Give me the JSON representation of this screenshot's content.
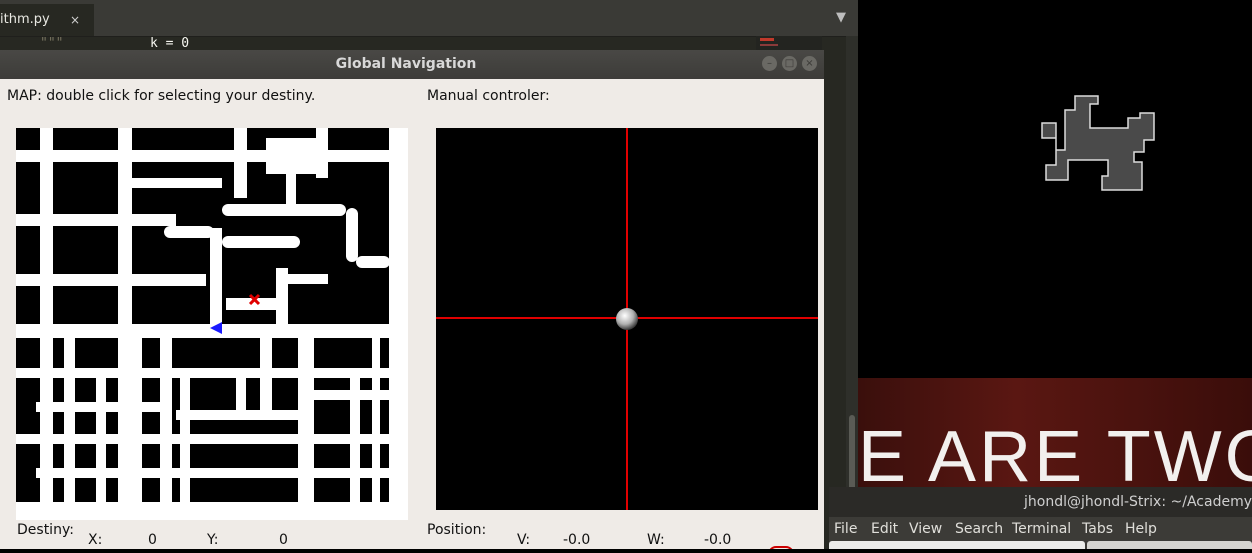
{
  "editor": {
    "tab_filename": "ithm.py",
    "tab_close": "×",
    "menu_arrow": "▼",
    "code_line_docstring": "\"\"\"",
    "code_line_assign": "k = 0"
  },
  "dialog": {
    "title": "Global Navigation",
    "map_label": "MAP: double click for selecting your destiny.",
    "manual_label": "Manual controler:",
    "destiny_label": "Destiny:",
    "x_label": "X:",
    "x_value": "0",
    "y_label": "Y:",
    "y_value": "0",
    "position_label": "Position:",
    "v_label": "V:",
    "v_value": "-0.0",
    "w_label": "W:",
    "w_value": "-0.0",
    "window_buttons": [
      "–",
      "□",
      "×"
    ]
  },
  "desktop": {
    "banner_text": "E ARE TWO"
  },
  "terminal": {
    "title": "jhondl@jhondl-Strix: ~/Academy",
    "menu": [
      "File",
      "Edit",
      "View",
      "Search",
      "Terminal",
      "Tabs",
      "Help"
    ]
  },
  "colors": {
    "crosshair": "#e00000",
    "target_marker": "#e00000",
    "robot_marker": "#1a1aff"
  }
}
